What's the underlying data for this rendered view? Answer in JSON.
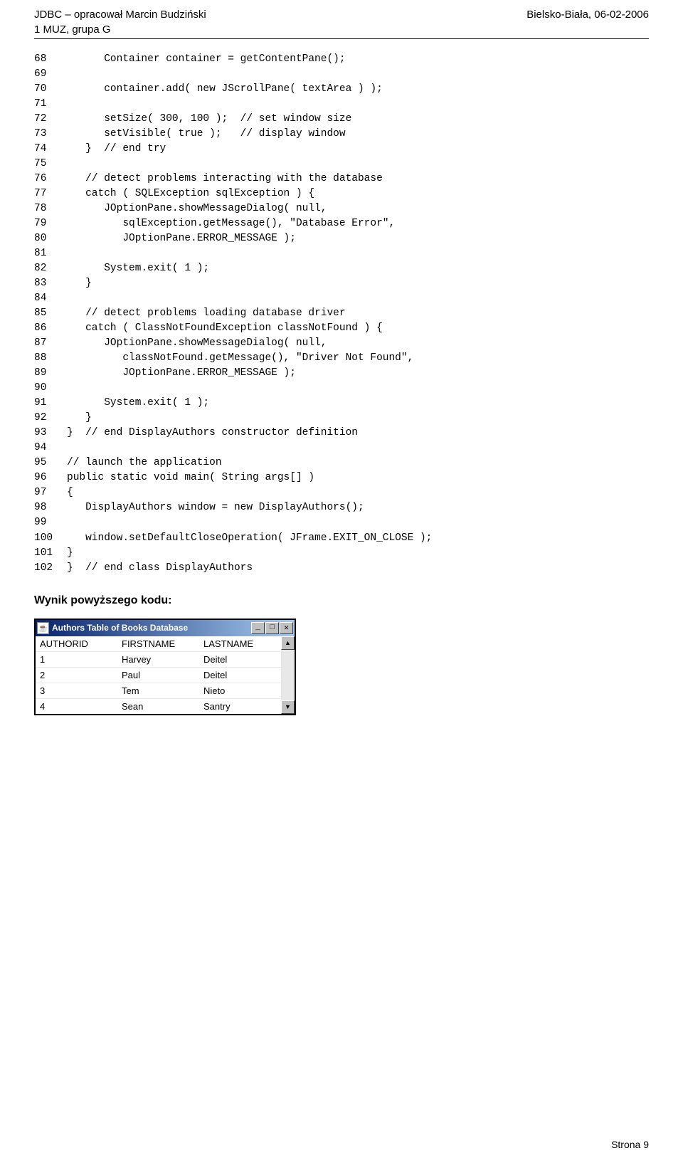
{
  "header": {
    "left_line1": "JDBC – opracował Marcin Budziński",
    "right": "Bielsko-Biała, 06-02-2006",
    "left_line2": "1 MUZ, grupa G"
  },
  "code_lines": [
    {
      "n": "68",
      "t": "      Container container = getContentPane();"
    },
    {
      "n": "69",
      "t": ""
    },
    {
      "n": "70",
      "t": "      container.add( new JScrollPane( textArea ) );"
    },
    {
      "n": "71",
      "t": ""
    },
    {
      "n": "72",
      "t": "      setSize( 300, 100 );  // set window size"
    },
    {
      "n": "73",
      "t": "      setVisible( true );   // display window"
    },
    {
      "n": "74",
      "t": "   }  // end try"
    },
    {
      "n": "75",
      "t": ""
    },
    {
      "n": "76",
      "t": "   // detect problems interacting with the database"
    },
    {
      "n": "77",
      "t": "   catch ( SQLException sqlException ) {"
    },
    {
      "n": "78",
      "t": "      JOptionPane.showMessageDialog( null,"
    },
    {
      "n": "79",
      "t": "         sqlException.getMessage(), \"Database Error\","
    },
    {
      "n": "80",
      "t": "         JOptionPane.ERROR_MESSAGE );"
    },
    {
      "n": "81",
      "t": ""
    },
    {
      "n": "82",
      "t": "      System.exit( 1 );"
    },
    {
      "n": "83",
      "t": "   }"
    },
    {
      "n": "84",
      "t": ""
    },
    {
      "n": "85",
      "t": "   // detect problems loading database driver"
    },
    {
      "n": "86",
      "t": "   catch ( ClassNotFoundException classNotFound ) {"
    },
    {
      "n": "87",
      "t": "      JOptionPane.showMessageDialog( null,"
    },
    {
      "n": "88",
      "t": "         classNotFound.getMessage(), \"Driver Not Found\","
    },
    {
      "n": "89",
      "t": "         JOptionPane.ERROR_MESSAGE );"
    },
    {
      "n": "90",
      "t": ""
    },
    {
      "n": "91",
      "t": "      System.exit( 1 );"
    },
    {
      "n": "92",
      "t": "   }"
    },
    {
      "n": "93",
      "t": "}  // end DisplayAuthors constructor definition"
    },
    {
      "n": "94",
      "t": ""
    },
    {
      "n": "95",
      "t": "// launch the application"
    },
    {
      "n": "96",
      "t": "public static void main( String args[] )"
    },
    {
      "n": "97",
      "t": "{"
    },
    {
      "n": "98",
      "t": "   DisplayAuthors window = new DisplayAuthors();"
    },
    {
      "n": "99",
      "t": ""
    },
    {
      "n": "100",
      "t": "   window.setDefaultCloseOperation( JFrame.EXIT_ON_CLOSE );"
    },
    {
      "n": "101",
      "t": "}"
    },
    {
      "n": "102",
      "t": "}  // end class DisplayAuthors"
    }
  ],
  "result_heading": "Wynik powyższego kodu:",
  "window_title": "Authors Table of Books Database",
  "table": {
    "columns": [
      "AUTHORID",
      "FIRSTNAME",
      "LASTNAME"
    ],
    "rows": [
      [
        "1",
        "Harvey",
        "Deitel"
      ],
      [
        "2",
        "Paul",
        "Deitel"
      ],
      [
        "3",
        "Tem",
        "Nieto"
      ],
      [
        "4",
        "Sean",
        "Santry"
      ]
    ]
  },
  "footer": "Strona 9",
  "glyphs": {
    "coffee": "☕",
    "up": "▲",
    "down": "▼",
    "min": "_",
    "max": "□",
    "close": "✕"
  }
}
